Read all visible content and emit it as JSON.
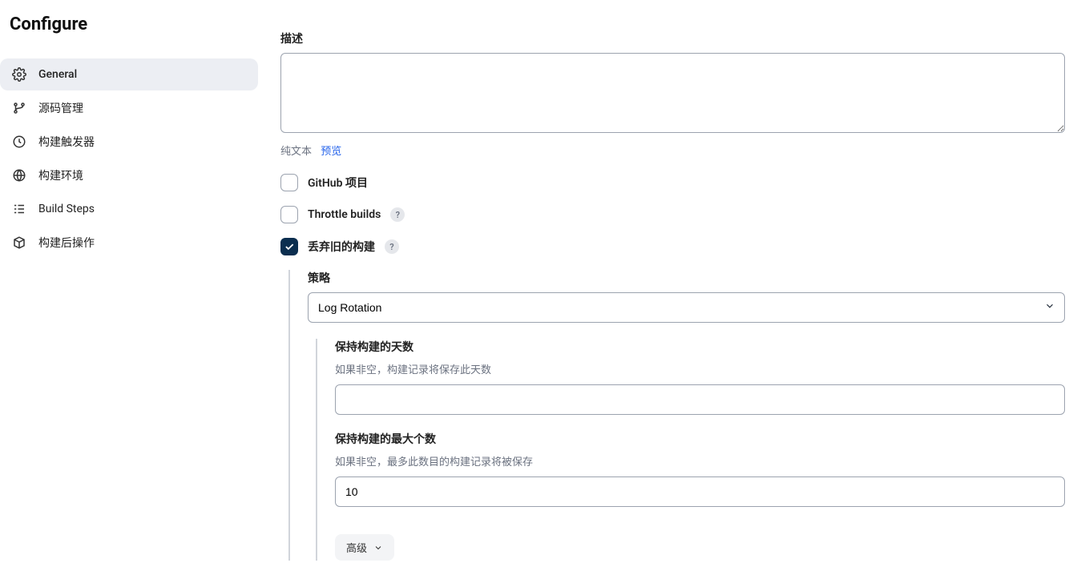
{
  "pageTitle": "Configure",
  "sidebar": {
    "items": [
      {
        "label": "General",
        "icon": "gear-icon",
        "active": true
      },
      {
        "label": "源码管理",
        "icon": "branch-icon",
        "active": false
      },
      {
        "label": "构建触发器",
        "icon": "clock-icon",
        "active": false
      },
      {
        "label": "构建环境",
        "icon": "globe-icon",
        "active": false
      },
      {
        "label": "Build Steps",
        "icon": "steps-icon",
        "active": false
      },
      {
        "label": "构建后操作",
        "icon": "box-icon",
        "active": false
      }
    ]
  },
  "main": {
    "descriptionLabel": "描述",
    "descriptionValue": "",
    "editorModePlain": "纯文本",
    "editorModePreview": "预览",
    "checkGithub": "GitHub 项目",
    "checkThrottle": "Throttle builds",
    "checkDiscard": "丢弃旧的构建",
    "strategyLabel": "策略",
    "strategyValue": "Log Rotation",
    "keepDaysLabel": "保持构建的天数",
    "keepDaysHelp": "如果非空，构建记录将保存此天数",
    "keepDaysValue": "",
    "keepMaxLabel": "保持构建的最大个数",
    "keepMaxHelp": "如果非空，最多此数目的构建记录将被保存",
    "keepMaxValue": "10",
    "advancedLabel": "高级",
    "helpChar": "?"
  }
}
